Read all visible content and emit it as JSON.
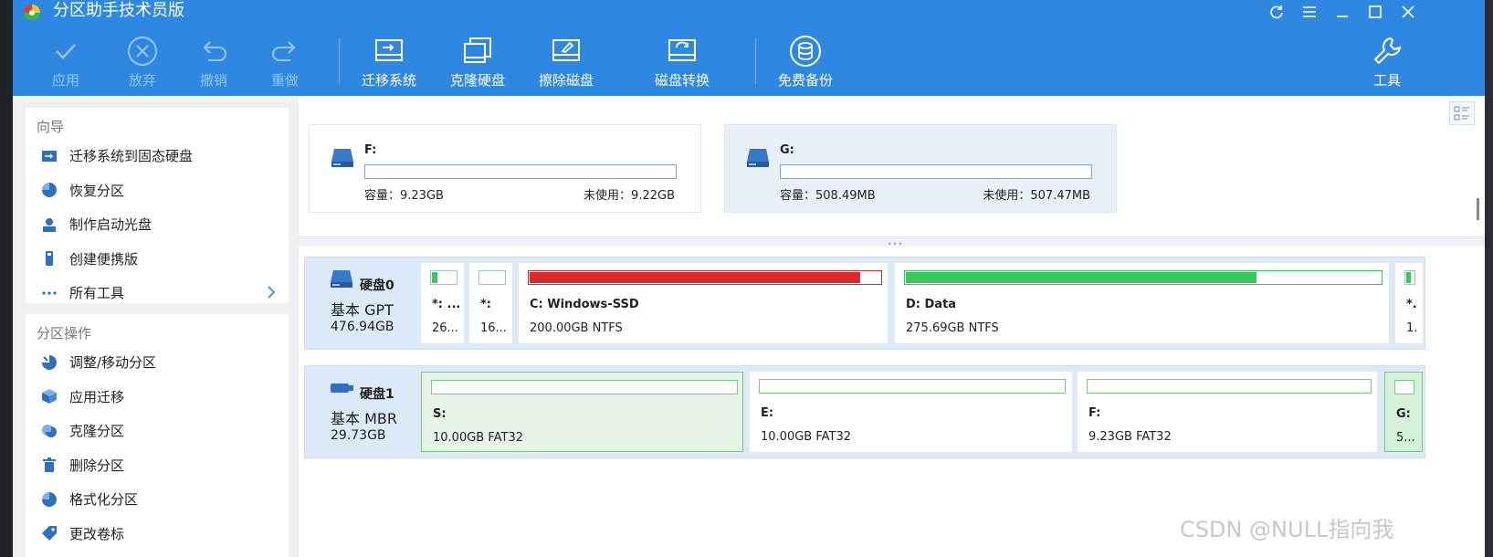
{
  "app": {
    "title": "分区助手技术员版"
  },
  "toolbar": {
    "apply": "应用",
    "discard": "放弃",
    "undo": "撤销",
    "redo": "重做",
    "migrate": "迁移系统",
    "clone_disk": "克隆硬盘",
    "wipe_disk": "擦除磁盘",
    "convert_disk": "磁盘转换",
    "backup": "免费备份",
    "tools": "工具"
  },
  "wizard": {
    "heading": "向导",
    "items": [
      "迁移系统到固态硬盘",
      "恢复分区",
      "制作启动光盘",
      "创建便携版",
      "所有工具"
    ]
  },
  "operations": {
    "heading": "分区操作",
    "items": [
      "调整/移动分区",
      "应用迁移",
      "克隆分区",
      "删除分区",
      "格式化分区",
      "更改卷标"
    ]
  },
  "volumes": [
    {
      "name": "F:",
      "capacity": "容量：9.23GB",
      "free": "未使用：9.22GB"
    },
    {
      "name": "G:",
      "capacity": "容量：508.49MB",
      "free": "未使用：507.47MB"
    }
  ],
  "disks": [
    {
      "name": "硬盘0",
      "type": "基本 GPT",
      "size": "476.94GB",
      "partitions": [
        {
          "name": "*: ...",
          "info": "26..."
        },
        {
          "name": "*:",
          "info": "16..."
        },
        {
          "name": "C: Windows-SSD",
          "info": "200.00GB NTFS",
          "used": 0.98,
          "color": "#d62b2b"
        },
        {
          "name": "D: Data",
          "info": "275.69GB NTFS",
          "used": 0.74,
          "color": "#37c75a"
        },
        {
          "name": "*.",
          "info": "1."
        }
      ]
    },
    {
      "name": "硬盘1",
      "type": "基本 MBR",
      "size": "29.73GB",
      "partitions": [
        {
          "name": "S:",
          "info": "10.00GB FAT32"
        },
        {
          "name": "E:",
          "info": "10.00GB FAT32"
        },
        {
          "name": "F:",
          "info": "9.23GB FAT32"
        },
        {
          "name": "G:",
          "info": "5..."
        }
      ]
    }
  ],
  "watermark": "CSDN @NULL指向我",
  "colors": {
    "accent": "#2e87e0",
    "used_red": "#d62b2b",
    "used_green": "#37c75a"
  }
}
